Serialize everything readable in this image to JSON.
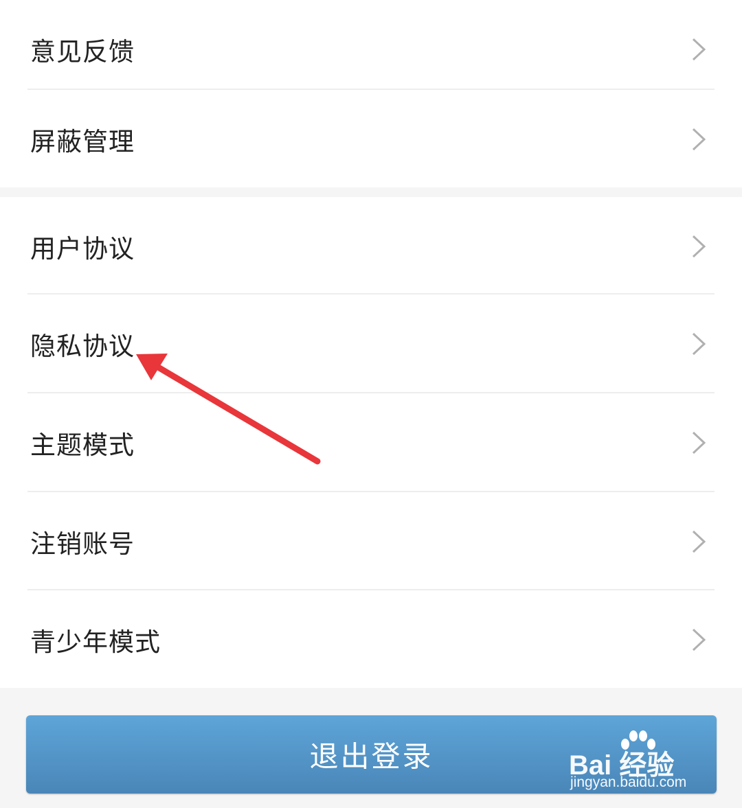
{
  "settings": {
    "group1": [
      {
        "label": "意见反馈"
      },
      {
        "label": "屏蔽管理"
      }
    ],
    "group2": [
      {
        "label": "用户协议"
      },
      {
        "label": "隐私协议"
      },
      {
        "label": "主题模式"
      },
      {
        "label": "注销账号"
      },
      {
        "label": "青少年模式"
      }
    ]
  },
  "logout_button": {
    "label": "退出登录"
  },
  "watermark": {
    "brand": "Bai  经验",
    "url": "jingyan.baidu.com"
  },
  "icons": {
    "row_chevron": "chevron-right-icon",
    "annotation": "red-arrow-annotation"
  },
  "colors": {
    "logout_top": "#5ea5d8",
    "logout_bottom": "#4a86b8",
    "annotation_arrow": "#e8363a",
    "chevron": "#b0b0b0"
  }
}
